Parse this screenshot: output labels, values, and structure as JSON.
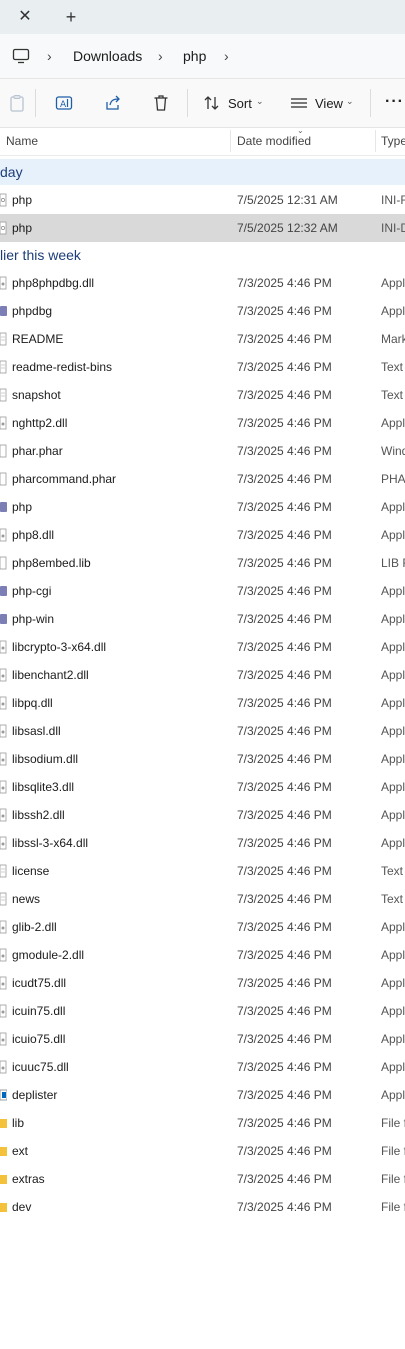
{
  "window": {
    "new_tab_glyph": "+",
    "close_tab_glyph": "✕"
  },
  "address": {
    "crumbs": [
      "Downloads",
      "php"
    ]
  },
  "commands": {
    "sort_label": "Sort",
    "view_label": "View",
    "more_label": "···"
  },
  "columns": {
    "name": "Name",
    "date_modified": "Date modified",
    "type": "Type"
  },
  "groups": {
    "today": "day",
    "earlier_this_week": "lier this week"
  },
  "files_today": [
    {
      "name": "php",
      "date": "7/5/2025 12:31 AM",
      "type": "INI-F",
      "icon": "ini-file-icon"
    },
    {
      "name": "php",
      "date": "7/5/2025 12:32 AM",
      "type": "INI-D",
      "icon": "ini-file-icon",
      "selected": true
    }
  ],
  "files_earlier": [
    {
      "name": "php8phpdbg.dll",
      "date": "7/3/2025 4:46 PM",
      "type": "Appl",
      "icon": "dll-file-icon"
    },
    {
      "name": "phpdbg",
      "date": "7/3/2025 4:46 PM",
      "type": "Appl",
      "icon": "php-app-icon"
    },
    {
      "name": "README",
      "date": "7/3/2025 4:46 PM",
      "type": "Mark",
      "icon": "text-file-icon"
    },
    {
      "name": "readme-redist-bins",
      "date": "7/3/2025 4:46 PM",
      "type": "Text",
      "icon": "text-file-icon"
    },
    {
      "name": "snapshot",
      "date": "7/3/2025 4:46 PM",
      "type": "Text",
      "icon": "text-file-icon"
    },
    {
      "name": "nghttp2.dll",
      "date": "7/3/2025 4:46 PM",
      "type": "Appl",
      "icon": "dll-file-icon"
    },
    {
      "name": "phar.phar",
      "date": "7/3/2025 4:46 PM",
      "type": "Wind",
      "icon": "generic-file-icon"
    },
    {
      "name": "pharcommand.phar",
      "date": "7/3/2025 4:46 PM",
      "type": "PHA",
      "icon": "generic-file-icon"
    },
    {
      "name": "php",
      "date": "7/3/2025 4:46 PM",
      "type": "Appl",
      "icon": "php-app-icon"
    },
    {
      "name": "php8.dll",
      "date": "7/3/2025 4:46 PM",
      "type": "Appl",
      "icon": "dll-file-icon"
    },
    {
      "name": "php8embed.lib",
      "date": "7/3/2025 4:46 PM",
      "type": "LIB F",
      "icon": "generic-file-icon"
    },
    {
      "name": "php-cgi",
      "date": "7/3/2025 4:46 PM",
      "type": "Appl",
      "icon": "php-app-icon"
    },
    {
      "name": "php-win",
      "date": "7/3/2025 4:46 PM",
      "type": "Appl",
      "icon": "php-app-icon"
    },
    {
      "name": "libcrypto-3-x64.dll",
      "date": "7/3/2025 4:46 PM",
      "type": "Appl",
      "icon": "dll-file-icon"
    },
    {
      "name": "libenchant2.dll",
      "date": "7/3/2025 4:46 PM",
      "type": "Appl",
      "icon": "dll-file-icon"
    },
    {
      "name": "libpq.dll",
      "date": "7/3/2025 4:46 PM",
      "type": "Appl",
      "icon": "dll-file-icon"
    },
    {
      "name": "libsasl.dll",
      "date": "7/3/2025 4:46 PM",
      "type": "Appl",
      "icon": "dll-file-icon"
    },
    {
      "name": "libsodium.dll",
      "date": "7/3/2025 4:46 PM",
      "type": "Appl",
      "icon": "dll-file-icon"
    },
    {
      "name": "libsqlite3.dll",
      "date": "7/3/2025 4:46 PM",
      "type": "Appl",
      "icon": "dll-file-icon"
    },
    {
      "name": "libssh2.dll",
      "date": "7/3/2025 4:46 PM",
      "type": "Appl",
      "icon": "dll-file-icon"
    },
    {
      "name": "libssl-3-x64.dll",
      "date": "7/3/2025 4:46 PM",
      "type": "Appl",
      "icon": "dll-file-icon"
    },
    {
      "name": "license",
      "date": "7/3/2025 4:46 PM",
      "type": "Text",
      "icon": "text-file-icon"
    },
    {
      "name": "news",
      "date": "7/3/2025 4:46 PM",
      "type": "Text",
      "icon": "text-file-icon"
    },
    {
      "name": "glib-2.dll",
      "date": "7/3/2025 4:46 PM",
      "type": "Appl",
      "icon": "dll-file-icon"
    },
    {
      "name": "gmodule-2.dll",
      "date": "7/3/2025 4:46 PM",
      "type": "Appl",
      "icon": "dll-file-icon"
    },
    {
      "name": "icudt75.dll",
      "date": "7/3/2025 4:46 PM",
      "type": "Appl",
      "icon": "dll-file-icon"
    },
    {
      "name": "icuin75.dll",
      "date": "7/3/2025 4:46 PM",
      "type": "Appl",
      "icon": "dll-file-icon"
    },
    {
      "name": "icuio75.dll",
      "date": "7/3/2025 4:46 PM",
      "type": "Appl",
      "icon": "dll-file-icon"
    },
    {
      "name": "icuuc75.dll",
      "date": "7/3/2025 4:46 PM",
      "type": "Appl",
      "icon": "dll-file-icon"
    },
    {
      "name": "deplister",
      "date": "7/3/2025 4:46 PM",
      "type": "Appl",
      "icon": "exe-app-icon"
    },
    {
      "name": "lib",
      "date": "7/3/2025 4:46 PM",
      "type": "File f",
      "icon": "folder-icon"
    },
    {
      "name": "ext",
      "date": "7/3/2025 4:46 PM",
      "type": "File f",
      "icon": "folder-icon"
    },
    {
      "name": "extras",
      "date": "7/3/2025 4:46 PM",
      "type": "File f",
      "icon": "folder-icon"
    },
    {
      "name": "dev",
      "date": "7/3/2025 4:46 PM",
      "type": "File f",
      "icon": "folder-icon"
    }
  ],
  "colors": {
    "accent": "#0067c0",
    "group_text": "#1c3d7a",
    "selected_row": "#d9d9d9",
    "today_band": "#e7f1fb",
    "folder": "#f3c13a",
    "php_icon": "#7b7fb5"
  }
}
